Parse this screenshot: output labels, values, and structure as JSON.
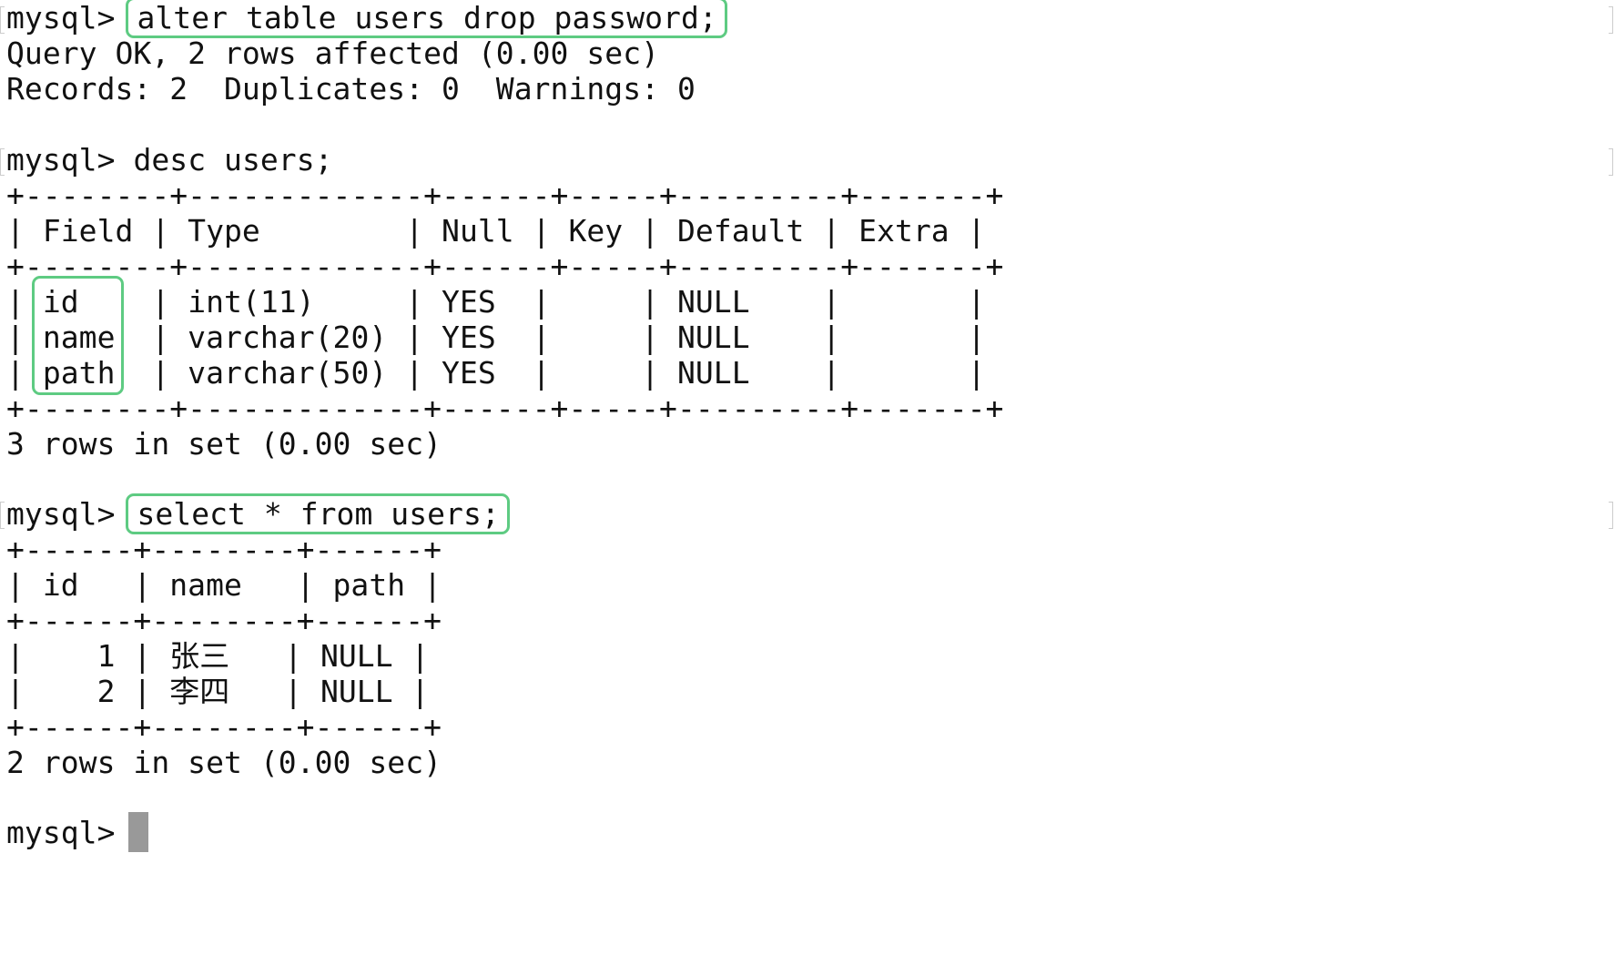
{
  "terminal": {
    "prompt": "mysql> ",
    "commands": {
      "alter": "alter table users drop password;",
      "desc": "desc users;",
      "select": "select * from users;"
    },
    "alter_output": [
      "Query OK, 2 rows affected (0.00 sec)",
      "Records: 2  Duplicates: 0  Warnings: 0"
    ],
    "desc_table": {
      "border": "+--------+-------------+------+-----+---------+-------+",
      "header": "| Field | Type        | Null | Key | Default | Extra |",
      "rows": [
        {
          "pre": "| ",
          "field": "id",
          "rest": "    | int(11)     | YES  |     | NULL    |       |"
        },
        {
          "pre": "| ",
          "field": "name",
          "rest": "  | varchar(20) | YES  |     | NULL    |       |"
        },
        {
          "pre": "| ",
          "field": "path",
          "rest": "  | varchar(50) | YES  |     | NULL    |       |"
        }
      ],
      "footer": "3 rows in set (0.00 sec)"
    },
    "select_table": {
      "border": "+------+--------+------+",
      "header": "| id   | name   | path |",
      "rows": [
        "|    1 | 张三   | NULL |",
        "|    2 | 李四   | NULL |"
      ],
      "footer": "2 rows in set (0.00 sec)"
    },
    "highlight_color": "#5ecb82",
    "cursor_color": "#999999"
  }
}
